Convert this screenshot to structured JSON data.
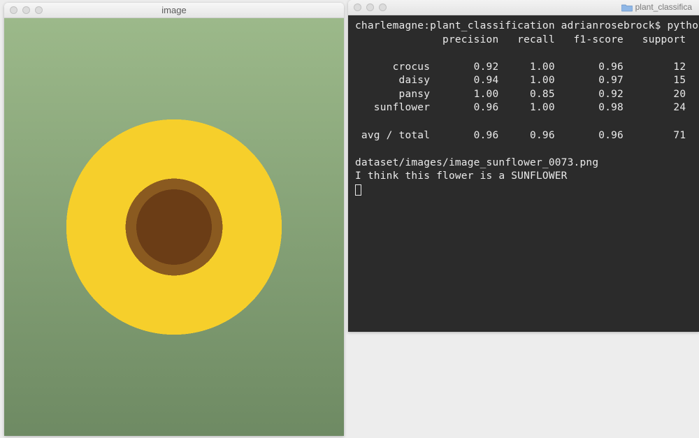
{
  "image_window": {
    "title": "image"
  },
  "terminal_window": {
    "folder_label": "plant_classifica",
    "prompt": "charlemagne:plant_classification adrianrosebrock$ python",
    "columns": {
      "c1": "precision",
      "c2": "recall",
      "c3": "f1-score",
      "c4": "support"
    },
    "rows": [
      {
        "name": "crocus",
        "precision": "0.92",
        "recall": "1.00",
        "f1": "0.96",
        "support": "12"
      },
      {
        "name": "daisy",
        "precision": "0.94",
        "recall": "1.00",
        "f1": "0.97",
        "support": "15"
      },
      {
        "name": "pansy",
        "precision": "1.00",
        "recall": "0.85",
        "f1": "0.92",
        "support": "20"
      },
      {
        "name": "sunflower",
        "precision": "0.96",
        "recall": "1.00",
        "f1": "0.98",
        "support": "24"
      }
    ],
    "total": {
      "name": "avg / total",
      "precision": "0.96",
      "recall": "0.96",
      "f1": "0.96",
      "support": "71"
    },
    "path_line": "dataset/images/image_sunflower_0073.png",
    "result_line": "I think this flower is a SUNFLOWER"
  }
}
